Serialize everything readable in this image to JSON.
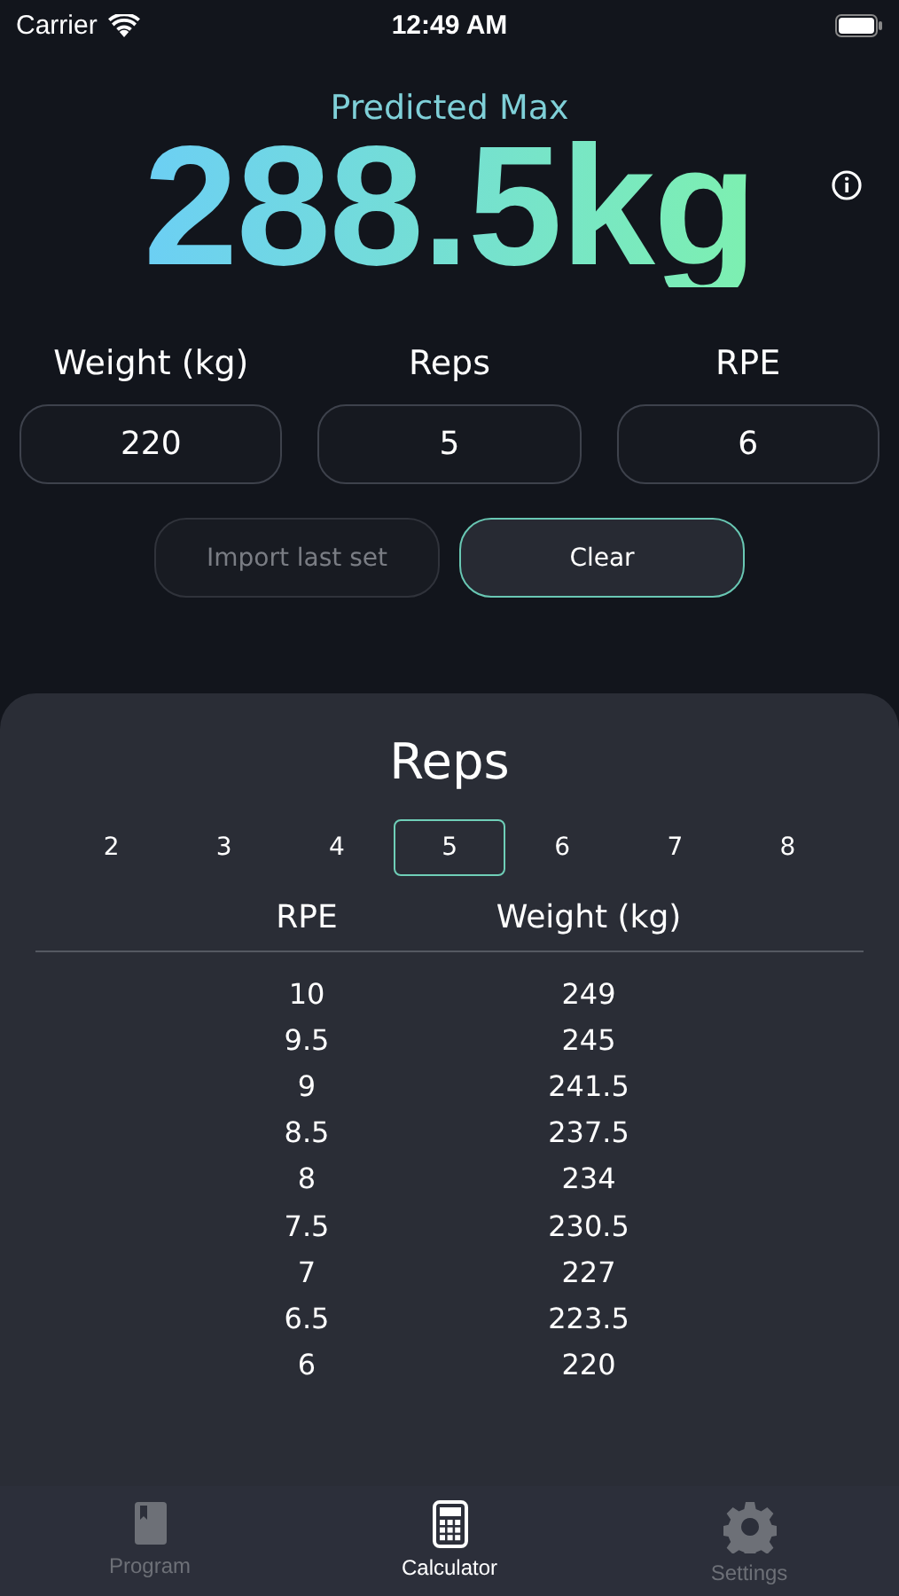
{
  "status_bar": {
    "carrier": "Carrier",
    "time": "12:49 AM"
  },
  "header": {
    "label": "Predicted Max",
    "value": "288.5kg"
  },
  "inputs": [
    {
      "label": "Weight (kg)",
      "value": "220"
    },
    {
      "label": "Reps",
      "value": "5"
    },
    {
      "label": "RPE",
      "value": "6"
    }
  ],
  "buttons": [
    {
      "label": "Import last set",
      "disabled": true
    },
    {
      "label": "Clear",
      "disabled": false
    }
  ],
  "sheet": {
    "title": "Reps",
    "reps": [
      {
        "label": "2",
        "selected": false
      },
      {
        "label": "3",
        "selected": false
      },
      {
        "label": "4",
        "selected": false
      },
      {
        "label": "5",
        "selected": true
      },
      {
        "label": "6",
        "selected": false
      },
      {
        "label": "7",
        "selected": false
      },
      {
        "label": "8",
        "selected": false
      }
    ],
    "table": {
      "columns": [
        "RPE",
        "Weight (kg)"
      ],
      "rows": [
        [
          "10",
          "249"
        ],
        [
          "9.5",
          "245"
        ],
        [
          "9",
          "241.5"
        ],
        [
          "8.5",
          "237.5"
        ],
        [
          "8",
          "234"
        ],
        [
          "7.5",
          "230.5"
        ],
        [
          "7",
          "227"
        ],
        [
          "6.5",
          "223.5"
        ],
        [
          "6",
          "220"
        ]
      ]
    }
  },
  "tab_bar": [
    {
      "label": "Program",
      "kind": "book",
      "selected": false
    },
    {
      "label": "Calculator",
      "kind": "calculator",
      "selected": true
    },
    {
      "label": "Settings",
      "kind": "gear",
      "selected": false
    }
  ]
}
